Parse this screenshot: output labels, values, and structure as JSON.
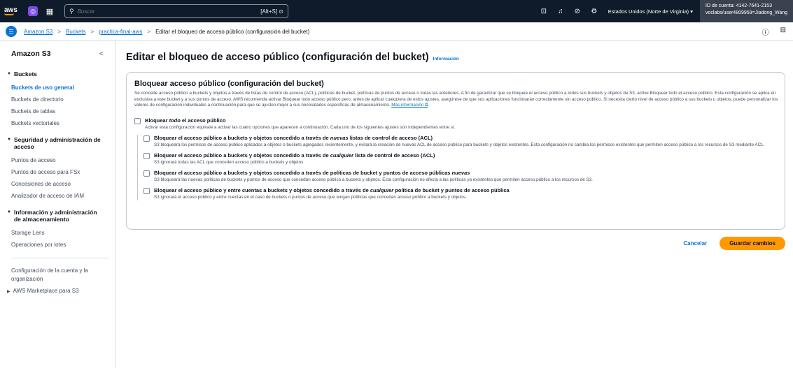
{
  "topnav": {
    "logo": "aws",
    "search_placeholder": "Buscar",
    "search_shortcut": "[Alt+S]",
    "region": "Estados Unidos (Norte de Virginia)",
    "account_id": "ID de cuenta: 4142-7641-2153",
    "account_user": "voclabs/user4809959=Jiadong_Wang"
  },
  "breadcrumbs": {
    "items": [
      "Amazon S3",
      "Buckets",
      "practica-final-aws"
    ],
    "current": "Editar el bloqueo de acceso público (configuración del bucket)"
  },
  "sidebar": {
    "title": "Amazon S3",
    "sections": [
      {
        "heading": "Buckets",
        "items": [
          "Buckets de uso general",
          "Buckets de directorio",
          "Buckets de tablas",
          "Buckets vectoriales"
        ]
      },
      {
        "heading": "Seguridad y administración de acceso",
        "items": [
          "Puntos de acceso",
          "Puntos de acceso para FSx",
          "Concesiones de acceso",
          "Analizador de acceso de IAM"
        ]
      },
      {
        "heading": "Información y administración de almacenamiento",
        "items": [
          "Storage Lens",
          "Operaciones por lotes"
        ]
      }
    ],
    "footer_link": "Configuración de la cuenta y la organización",
    "marketplace": "AWS Marketplace para S3"
  },
  "main": {
    "title": "Editar el bloqueo de acceso público (configuración del bucket)",
    "info": "Información",
    "panel": {
      "title": "Bloquear acceso público (configuración del bucket)",
      "description": "Se concede acceso público a buckets y objetos a través de listas de control de acceso (ACL), políticas de bucket, políticas de puntos de acceso o todas las anteriores. A fin de garantizar que se bloquee el acceso público a todos sus buckets y objetos de S3, active Bloquear todo el acceso público. Esta configuración se aplica en exclusiva a este bucket y a sus puntos de acceso. AWS recomienda activar Bloquear todo acceso público pero, antes de aplicar cualquiera de estos ajustes, asegúrese de que sus aplicaciones funcionarán correctamente sin acceso público. Si necesita cierto nivel de acceso público a sus buckets u objetos, puede personalizar los valores de configuración individuales a continuación para que se ajusten mejor a sus necesidades específicas de almacenamiento.",
      "more_info": "Más información",
      "block_all": {
        "pre": "Bloquear ",
        "em": "todo",
        "post": " el acceso público",
        "desc": "Activar esta configuración equivale a activar las cuatro opciones que aparecen a continuación. Cada uno de los siguientes ajustes son independientes entre sí."
      },
      "options": [
        {
          "pre": "Bloquear el acceso público a buckets y objetos concedido a través de ",
          "em": "nuevas",
          "post": " listas de control de acceso (ACL)",
          "desc": "S3 bloqueará los permisos de acceso público aplicados a objetos o buckets agregados recientemente, y evitará la creación de nuevas ACL de acceso público para buckets y objetos existentes. Esta configuración no cambia los permisos existentes que permiten acceso público a los recursos de S3 mediante ACL."
        },
        {
          "pre": "Bloquear el acceso público a buckets y objetos concedido a través de ",
          "em": "cualquier",
          "post": " lista de control de acceso (ACL)",
          "desc": "S3 ignorará todas las ACL que conceden acceso público a buckets y objetos."
        },
        {
          "pre": "Bloquear el acceso público a buckets y objetos concedido a través de políticas de bucket y puntos de acceso públicas ",
          "em": "nuevas",
          "post": "",
          "desc": "S3 bloqueará las nuevas políticas de buckets y puntos de acceso que concedan acceso público a buckets y objetos. Esta configuración no afecta a las políticas ya existentes que permiten acceso público a los recursos de S3."
        },
        {
          "pre": "Bloquear el acceso público y entre cuentas a buckets y objetos concedido a través de ",
          "em": "cualquier",
          "post": " política de bucket y puntos de acceso pública",
          "desc": "S3 ignorará el acceso público y entre cuentas en el caso de buckets o puntos de acceso que tengan políticas que concedan acceso público a buckets y objetos."
        }
      ]
    },
    "cancel": "Cancelar",
    "save": "Guardar cambios"
  },
  "colors": {
    "link": "#0972d3",
    "primary_button": "#ff9900",
    "nav_bg": "#0f1b2a"
  }
}
